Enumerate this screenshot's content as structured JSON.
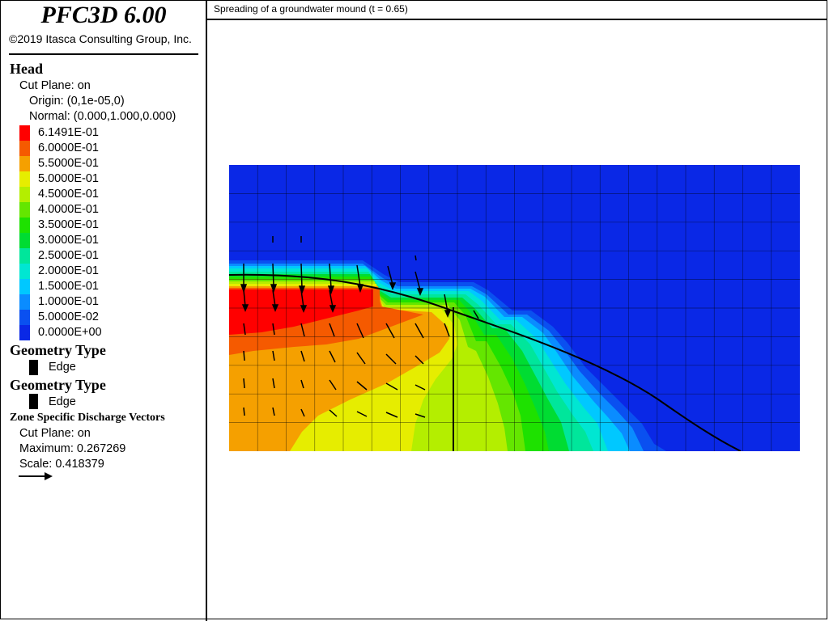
{
  "app": {
    "title": "PFC3D 6.00",
    "copyright": "©2019 Itasca Consulting Group, Inc."
  },
  "plot": {
    "title": "Spreading of a groundwater mound (t = 0.65)"
  },
  "legend": {
    "head": {
      "heading": "Head",
      "cut_plane": "Cut Plane: on",
      "origin": "Origin: (0,1e-05,0)",
      "normal": "Normal: (0.000,1.000,0.000)",
      "contours": [
        {
          "label": "6.1491E-01",
          "color": "#ff0000"
        },
        {
          "label": "6.0000E-01",
          "color": "#f55a00"
        },
        {
          "label": "5.5000E-01",
          "color": "#f5a000"
        },
        {
          "label": "5.0000E-01",
          "color": "#e6ed00"
        },
        {
          "label": "4.5000E-01",
          "color": "#b4ee00"
        },
        {
          "label": "4.0000E-01",
          "color": "#64e600"
        },
        {
          "label": "3.5000E-01",
          "color": "#1ee100"
        },
        {
          "label": "3.0000E-01",
          "color": "#00dc32"
        },
        {
          "label": "2.5000E-01",
          "color": "#00e69b"
        },
        {
          "label": "2.0000E-01",
          "color": "#00e6d2"
        },
        {
          "label": "1.5000E-01",
          "color": "#00c8ff"
        },
        {
          "label": "1.0000E-01",
          "color": "#0a8cff"
        },
        {
          "label": "5.0000E-02",
          "color": "#0a50f0"
        },
        {
          "label": "0.0000E+00",
          "color": "#0a28e6"
        }
      ]
    },
    "geometry_1": {
      "heading": "Geometry Type",
      "item": "Edge"
    },
    "geometry_2": {
      "heading": "Geometry Type",
      "item": "Edge"
    },
    "discharge": {
      "heading": "Zone Specific Discharge Vectors",
      "cut_plane": "Cut Plane: on",
      "maximum": "Maximum: 0.267269",
      "scale": "Scale: 0.418379"
    }
  },
  "colors": {
    "bg": "#0a28e6",
    "grid": "#000000"
  }
}
